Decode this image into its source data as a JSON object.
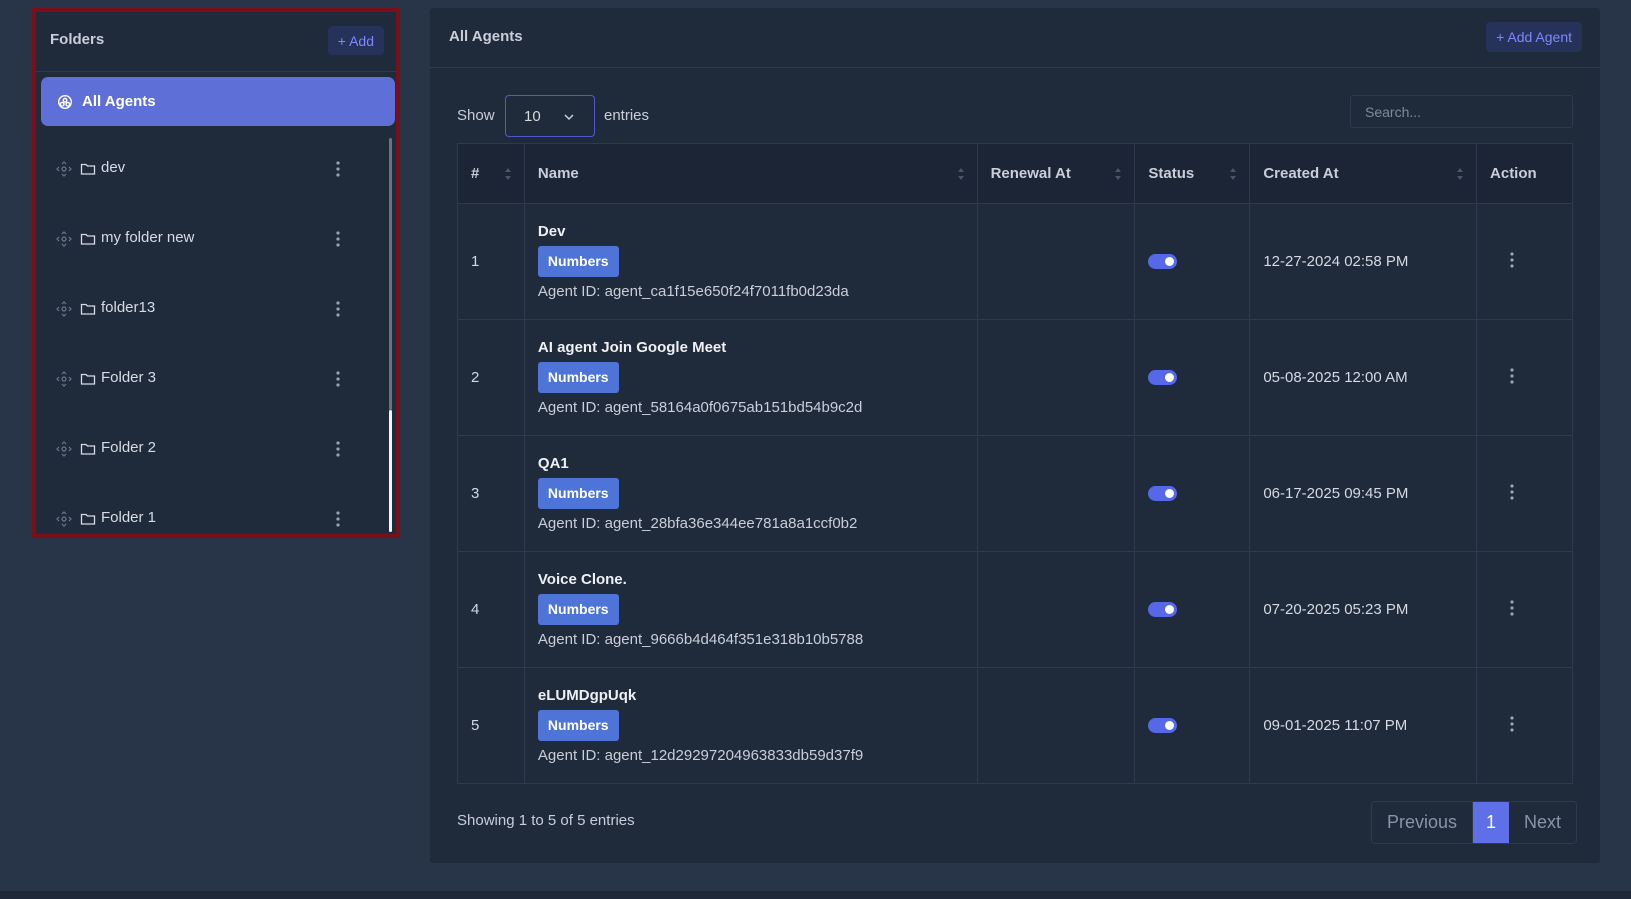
{
  "folders": {
    "title": "Folders",
    "add_label": "+ Add",
    "all_agents_label": "All Agents",
    "items": [
      {
        "name": "dev"
      },
      {
        "name": "my folder new"
      },
      {
        "name": "folder13"
      },
      {
        "name": "Folder 3"
      },
      {
        "name": "Folder 2"
      },
      {
        "name": "Folder 1"
      }
    ]
  },
  "main": {
    "title": "All Agents",
    "add_agent_label": "+ Add Agent",
    "show_label": "Show",
    "entries_value": "10",
    "entries_label": "entries",
    "search_placeholder": "Search...",
    "columns": [
      "#",
      "Name",
      "Renewal At",
      "Status",
      "Created At",
      "Action"
    ],
    "rows": [
      {
        "num": "1",
        "name": "Dev",
        "badge": "Numbers",
        "agent_id": "Agent ID: agent_ca1f15e650f24f7011fb0d23da",
        "renewal": "",
        "status": "on",
        "created": "12-27-2024 02:58 PM"
      },
      {
        "num": "2",
        "name": "AI agent Join Google Meet",
        "badge": "Numbers",
        "agent_id": "Agent ID: agent_58164a0f0675ab151bd54b9c2d",
        "renewal": "",
        "status": "on",
        "created": "05-08-2025 12:00 AM"
      },
      {
        "num": "3",
        "name": "QA1",
        "badge": "Numbers",
        "agent_id": "Agent ID: agent_28bfa36e344ee781a8a1ccf0b2",
        "renewal": "",
        "status": "on",
        "created": "06-17-2025 09:45 PM"
      },
      {
        "num": "4",
        "name": "Voice Clone.",
        "badge": "Numbers",
        "agent_id": "Agent ID: agent_9666b4d464f351e318b10b5788",
        "renewal": "",
        "status": "on",
        "created": "07-20-2025 05:23 PM"
      },
      {
        "num": "5",
        "name": "eLUMDgpUqk",
        "badge": "Numbers",
        "agent_id": "Agent ID: agent_12d29297204963833db59d37f9",
        "renewal": "",
        "status": "on",
        "created": "09-01-2025 11:07 PM"
      }
    ],
    "showing_text": "Showing 1 to 5 of 5 entries",
    "pagination": {
      "previous": "Previous",
      "current": "1",
      "next": "Next"
    }
  },
  "colors": {
    "accent": "#5f6fd8",
    "toggle_on": "#5668e8",
    "badge": "#4f74d7",
    "highlight_border": "#7a0f1a"
  }
}
